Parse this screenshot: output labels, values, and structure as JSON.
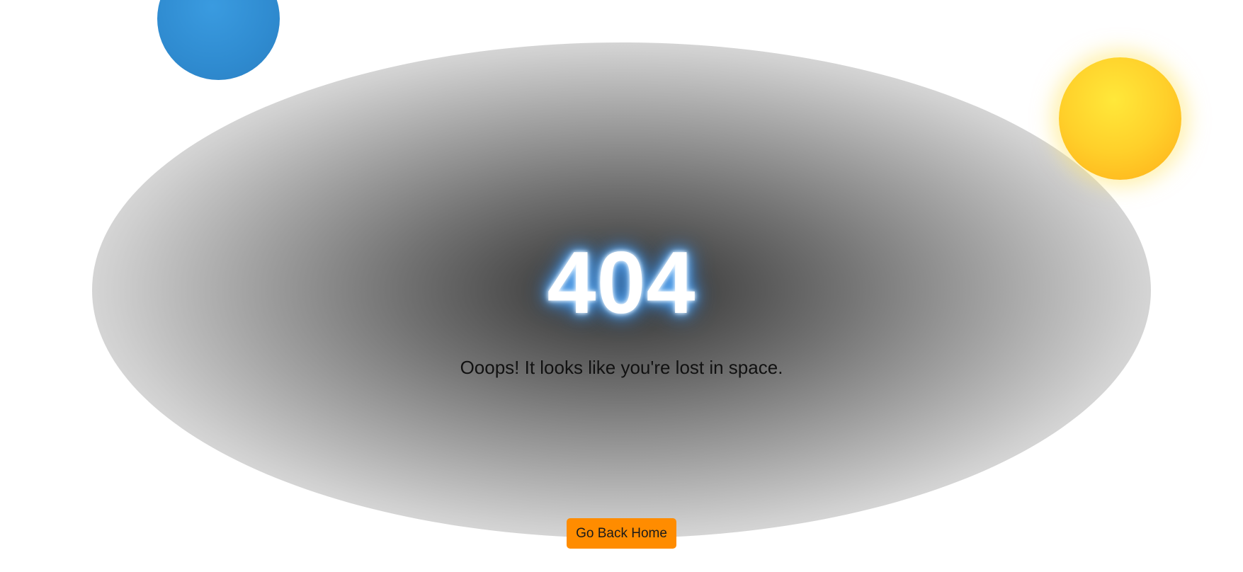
{
  "error": {
    "code": "404",
    "message": "Ooops! It looks like you're lost in space."
  },
  "actions": {
    "home_button_label": "Go Back Home"
  },
  "colors": {
    "background": "#ffffff",
    "space_center": "#3c3c3c",
    "code_glow": "#4aa8ff",
    "planet_blue": "#2f8bd0",
    "sun_yellow": "#ffd02a",
    "button_orange": "#ff8c00",
    "message_text": "#111111"
  },
  "decorations": {
    "planet": "blue-planet",
    "sun": "yellow-sun"
  }
}
